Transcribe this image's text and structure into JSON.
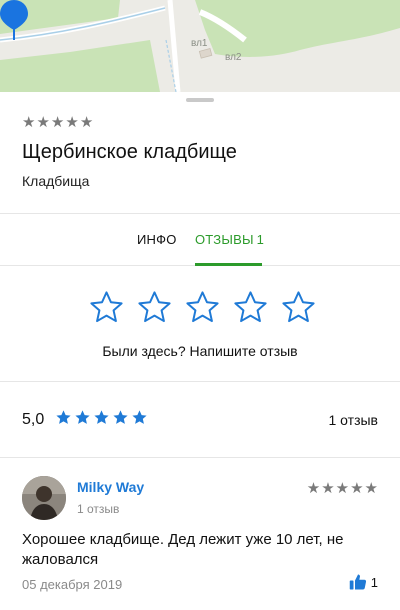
{
  "map": {
    "labels": [
      "вл1",
      "вл2"
    ]
  },
  "place": {
    "header_rating_stars": 0,
    "title": "Щербинское кладбище",
    "category": "Кладбища"
  },
  "tabs": {
    "info_label": "ИНФО",
    "reviews_label": "ОТЗЫВЫ",
    "reviews_count": "1"
  },
  "rate": {
    "prompt": "Были здесь? Напишите отзыв",
    "max_stars": 5
  },
  "summary": {
    "score": "5,0",
    "stars": 5,
    "count_text": "1 отзыв"
  },
  "review": {
    "author": "Milky Way",
    "author_meta": "1 отзыв",
    "stars": 0,
    "text": "Хорошее кладбище. Дед лежит уже 10 лет, не жаловался",
    "date": "05 декабря 2019",
    "likes": "1"
  },
  "colors": {
    "accent_green": "#2c9b2b",
    "star_blue": "#1f7ad6",
    "map_green": "#c5e0b4",
    "pin_blue": "#1a74e0"
  }
}
